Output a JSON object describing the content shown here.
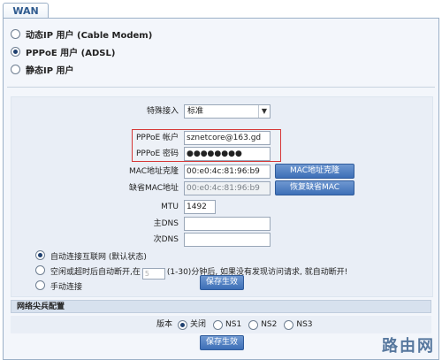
{
  "tab": {
    "label": "WAN"
  },
  "connection_modes": [
    {
      "label": "动态IP 用户 (Cable Modem)",
      "selected": false
    },
    {
      "label": "PPPoE 用户 (ADSL)",
      "selected": true
    },
    {
      "label": "静态IP 用户",
      "selected": false
    }
  ],
  "settings": {
    "special_access": {
      "label": "特殊接入",
      "value": "标准"
    },
    "pppoe_account": {
      "label": "PPPoE 帐户",
      "value": "sznetcore@163.gd"
    },
    "pppoe_password": {
      "label": "PPPoE 密码",
      "value": "●●●●●●●●"
    },
    "mac_clone": {
      "label": "MAC地址克隆",
      "value": "00:e0:4c:81:96:b9",
      "button": "MAC地址克隆"
    },
    "default_mac": {
      "label": "缺省MAC地址",
      "value": "00:e0:4c:81:96:b9",
      "button": "恢复缺省MAC"
    },
    "mtu": {
      "label": "MTU",
      "value": "1492"
    },
    "primary_dns": {
      "label": "主DNS",
      "value": ""
    },
    "secondary_dns": {
      "label": "次DNS",
      "value": ""
    }
  },
  "connect_options": [
    {
      "label": "自动连接互联网 (默认状态)",
      "selected": true
    },
    {
      "label_before": "空闲或超时后自动断开,在",
      "input_value": "5",
      "label_after": "(1-30)分钟后, 如果没有发现访问请求, 就自动断开!",
      "selected": false
    },
    {
      "label": "手动连接",
      "selected": false
    }
  ],
  "save_button": {
    "label": "保存生效"
  },
  "network_section": {
    "title": "网络尖兵配置",
    "version_label": "版本",
    "options": [
      {
        "label": "关闭",
        "selected": true
      },
      {
        "label": "NS1",
        "selected": false
      },
      {
        "label": "NS2",
        "selected": false
      },
      {
        "label": "NS3",
        "selected": false
      }
    ],
    "save_label": "保存生效"
  },
  "watermark": "路由网"
}
